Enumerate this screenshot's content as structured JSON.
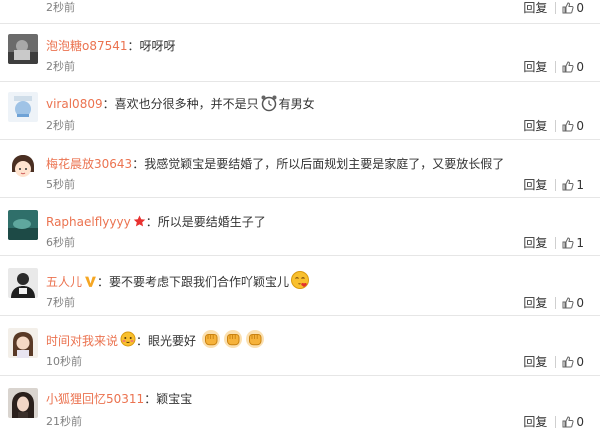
{
  "reply_label": "回复",
  "colors": {
    "username": "#eb7350",
    "text": "#333333",
    "time": "#808080",
    "separator": "#e6e6e6"
  },
  "comments": [
    {
      "username": "",
      "text": "",
      "time": "2秒前",
      "likes": "0",
      "avatar": "none",
      "emoji": []
    },
    {
      "username": "泡泡糖o87541",
      "text": "呀呀呀",
      "time": "2秒前",
      "likes": "0",
      "avatar": "dark-photo",
      "emoji": []
    },
    {
      "username": "viral0809",
      "text": "喜欢也分很多种，并不是只",
      "text_after": "有男女",
      "time": "2秒前",
      "likes": "0",
      "avatar": "default-blue",
      "emoji": [
        "alarm-clock-emoji"
      ]
    },
    {
      "username": "梅花晨放30643",
      "text": "我感觉颖宝是要结婚了，所以后面规划主要是家庭了，又要放长假了",
      "time": "5秒前",
      "likes": "1",
      "avatar": "cartoon-girl",
      "emoji": []
    },
    {
      "username": "Raphaelflyyyy",
      "text": "所以是要结婚生子了",
      "time": "6秒前",
      "likes": "1",
      "avatar": "teal-object",
      "badge": "star-icon",
      "emoji": []
    },
    {
      "username": "五人儿",
      "text": "要不要考虑下跟我们合作吖颖宝儿",
      "time": "7秒前",
      "likes": "0",
      "avatar": "person-dark",
      "badge": "vip-v-icon",
      "emoji": [
        "kiss-emoji"
      ]
    },
    {
      "username": "时间对我来说",
      "text": "眼光要好",
      "time": "10秒前",
      "likes": "0",
      "avatar": "girl-photo",
      "badge": "shy-emoji",
      "emoji": [
        "fist-emoji",
        "fist-emoji",
        "fist-emoji"
      ]
    },
    {
      "username": "小狐狸回忆50311",
      "text": "颖宝宝",
      "time": "21秒前",
      "likes": "0",
      "avatar": "woman-photo",
      "emoji": []
    }
  ]
}
